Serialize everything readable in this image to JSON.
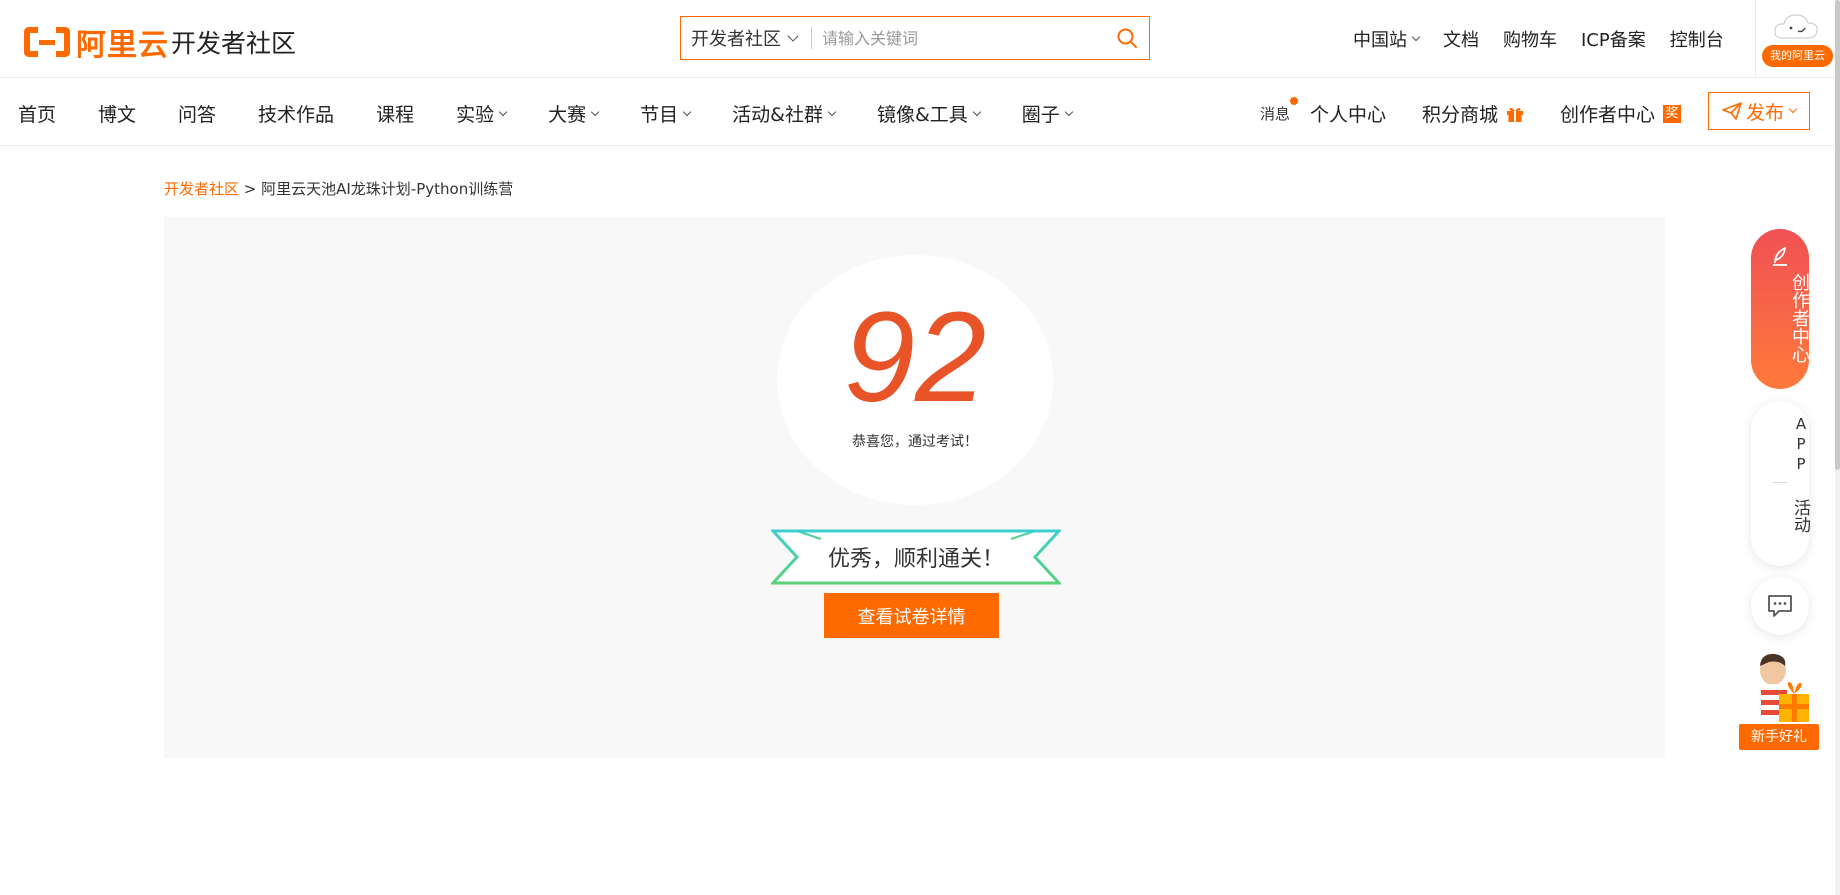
{
  "header": {
    "logo_text": "阿里云",
    "site_title": "开发者社区",
    "search": {
      "scope": "开发者社区",
      "placeholder": "请输入关键词"
    },
    "links": [
      {
        "label": "中国站",
        "has_dropdown": true
      },
      {
        "label": "文档"
      },
      {
        "label": "购物车"
      },
      {
        "label": "ICP备案"
      },
      {
        "label": "控制台"
      }
    ],
    "my_aliyun": "我的阿里云"
  },
  "nav": {
    "items": [
      {
        "label": "首页"
      },
      {
        "label": "博文"
      },
      {
        "label": "问答"
      },
      {
        "label": "技术作品"
      },
      {
        "label": "课程"
      },
      {
        "label": "实验",
        "has_dropdown": true
      },
      {
        "label": "大赛",
        "has_dropdown": true
      },
      {
        "label": "节目",
        "has_dropdown": true
      },
      {
        "label": "活动&社群",
        "has_dropdown": true
      },
      {
        "label": "镜像&工具",
        "has_dropdown": true
      },
      {
        "label": "圈子",
        "has_dropdown": true
      }
    ],
    "messages": "消息",
    "personal_center": "个人中心",
    "points_mall": "积分商城",
    "creator_center": "创作者中心",
    "creator_badge": "奖",
    "publish": "发布"
  },
  "breadcrumb": {
    "root": "开发者社区",
    "separator": " > ",
    "current": "阿里云天池AI龙珠计划-Python训练营"
  },
  "result": {
    "score": "92",
    "message": "恭喜您，通过考试！",
    "ribbon": "优秀，顺利通关！",
    "detail_button": "查看试卷详情"
  },
  "floating": {
    "creator_center": "创作者中心",
    "app": "APP",
    "activity": "活动",
    "newbie_gift": "新手好礼"
  },
  "colors": {
    "brand": "#ff6a00",
    "score": "#e85427",
    "ribbon_teal": "#3ccfcf",
    "ribbon_green": "#5ad17a"
  }
}
